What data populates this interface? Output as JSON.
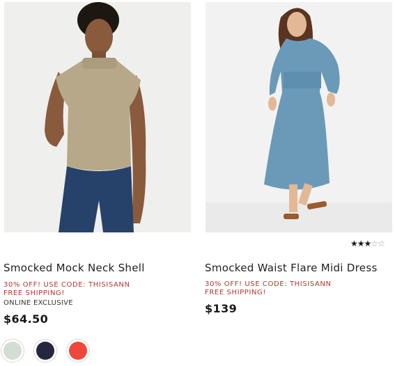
{
  "products": [
    {
      "title": "Smocked Mock Neck Shell",
      "promo": "30% OFF! USE CODE: THISISANN",
      "shipping": "FREE SHIPPING!",
      "badge": "ONLINE EXCLUSIVE",
      "price": "$64.50",
      "image_label": "Model wearing a sleeveless khaki smocked mock neck top with blue jeans",
      "swatches": [
        {
          "name": "light sage",
          "color": "#d3ddd4"
        },
        {
          "name": "navy",
          "color": "#24283f"
        },
        {
          "name": "red",
          "color": "#f0473c"
        }
      ]
    },
    {
      "title": "Smocked Waist Flare Midi Dress",
      "promo": "30% OFF! USE CODE: THISISANN",
      "shipping": "FREE SHIPPING!",
      "price": "$139",
      "rating": 3,
      "rating_max": 5,
      "image_label": "Model wearing a long-sleeve blue smocked waist midi dress with tan sandals"
    }
  ],
  "colors": {
    "promo": "#b3362f",
    "text": "#1a1a1a"
  }
}
